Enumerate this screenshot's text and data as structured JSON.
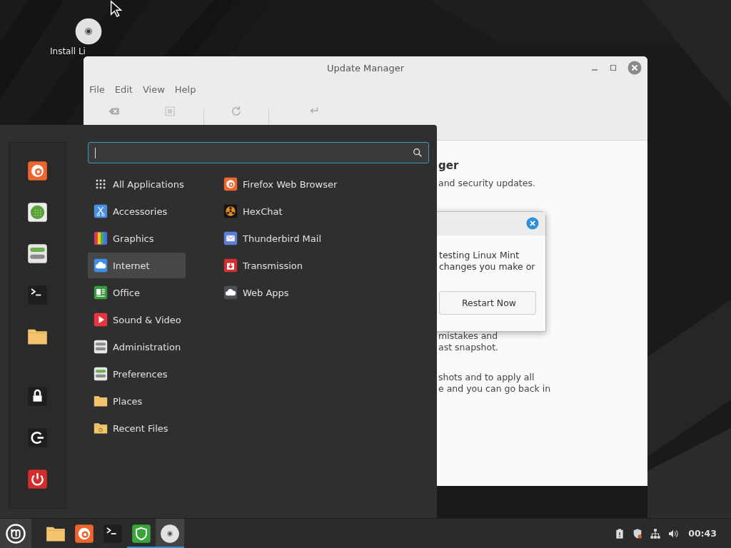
{
  "desktop_icons": [
    {
      "label": "Install Li",
      "kind": "disc"
    }
  ],
  "update_manager": {
    "title": "Update Manager",
    "menu": [
      "File",
      "Edit",
      "View",
      "Help"
    ],
    "toolbar": [
      {
        "kind": "clear"
      },
      {
        "kind": "select"
      },
      {
        "kind": "refresh"
      },
      {
        "kind": "install"
      }
    ],
    "heading": "ger",
    "paragraphs": [
      [
        "and security updates."
      ],
      [
        "mistakes and",
        "ast snapshot."
      ],
      [
        "shots and to apply all",
        "e and you can go back in"
      ]
    ]
  },
  "restart_dialog": {
    "lines": [
      "testing Linux Mint",
      "changes you make or"
    ],
    "button": "Restart Now"
  },
  "menu": {
    "favorites": [
      {
        "kind": "firefox"
      },
      {
        "kind": "software"
      },
      {
        "kind": "settings"
      },
      {
        "kind": "terminal"
      },
      {
        "kind": "folder"
      }
    ],
    "session": [
      {
        "kind": "lock"
      },
      {
        "kind": "logout"
      },
      {
        "kind": "power"
      }
    ],
    "categories": [
      {
        "label": "All Applications",
        "kind": "allapps",
        "selected": false
      },
      {
        "label": "Accessories",
        "kind": "scissors",
        "selected": false
      },
      {
        "label": "Graphics",
        "kind": "graphics",
        "selected": false
      },
      {
        "label": "Internet",
        "kind": "internet",
        "selected": true
      },
      {
        "label": "Office",
        "kind": "office",
        "selected": false
      },
      {
        "label": "Sound & Video",
        "kind": "play",
        "selected": false
      },
      {
        "label": "Administration",
        "kind": "admin",
        "selected": false
      },
      {
        "label": "Preferences",
        "kind": "settings",
        "selected": false
      },
      {
        "label": "Places",
        "kind": "folder",
        "selected": false
      },
      {
        "label": "Recent Files",
        "kind": "recent",
        "selected": false
      }
    ],
    "apps": [
      {
        "label": "Firefox Web Browser",
        "kind": "firefox"
      },
      {
        "label": "HexChat",
        "kind": "emblem"
      },
      {
        "label": "Thunderbird Mail",
        "kind": "mail"
      },
      {
        "label": "Transmission",
        "kind": "transmission"
      },
      {
        "label": "Web Apps",
        "kind": "webapps"
      }
    ]
  },
  "taskbar": {
    "launchers": [
      {
        "kind": "folder",
        "running": false,
        "selected": false
      },
      {
        "kind": "firefox",
        "running": false,
        "selected": false
      },
      {
        "kind": "terminal",
        "running": false,
        "selected": false
      },
      {
        "kind": "shield",
        "running": true,
        "selected": false
      },
      {
        "kind": "disc",
        "running": true,
        "selected": true
      }
    ],
    "tray": [
      {
        "kind": "clipboard"
      },
      {
        "kind": "shieldalert"
      },
      {
        "kind": "network"
      },
      {
        "kind": "volume"
      }
    ],
    "clock": "00:43"
  }
}
